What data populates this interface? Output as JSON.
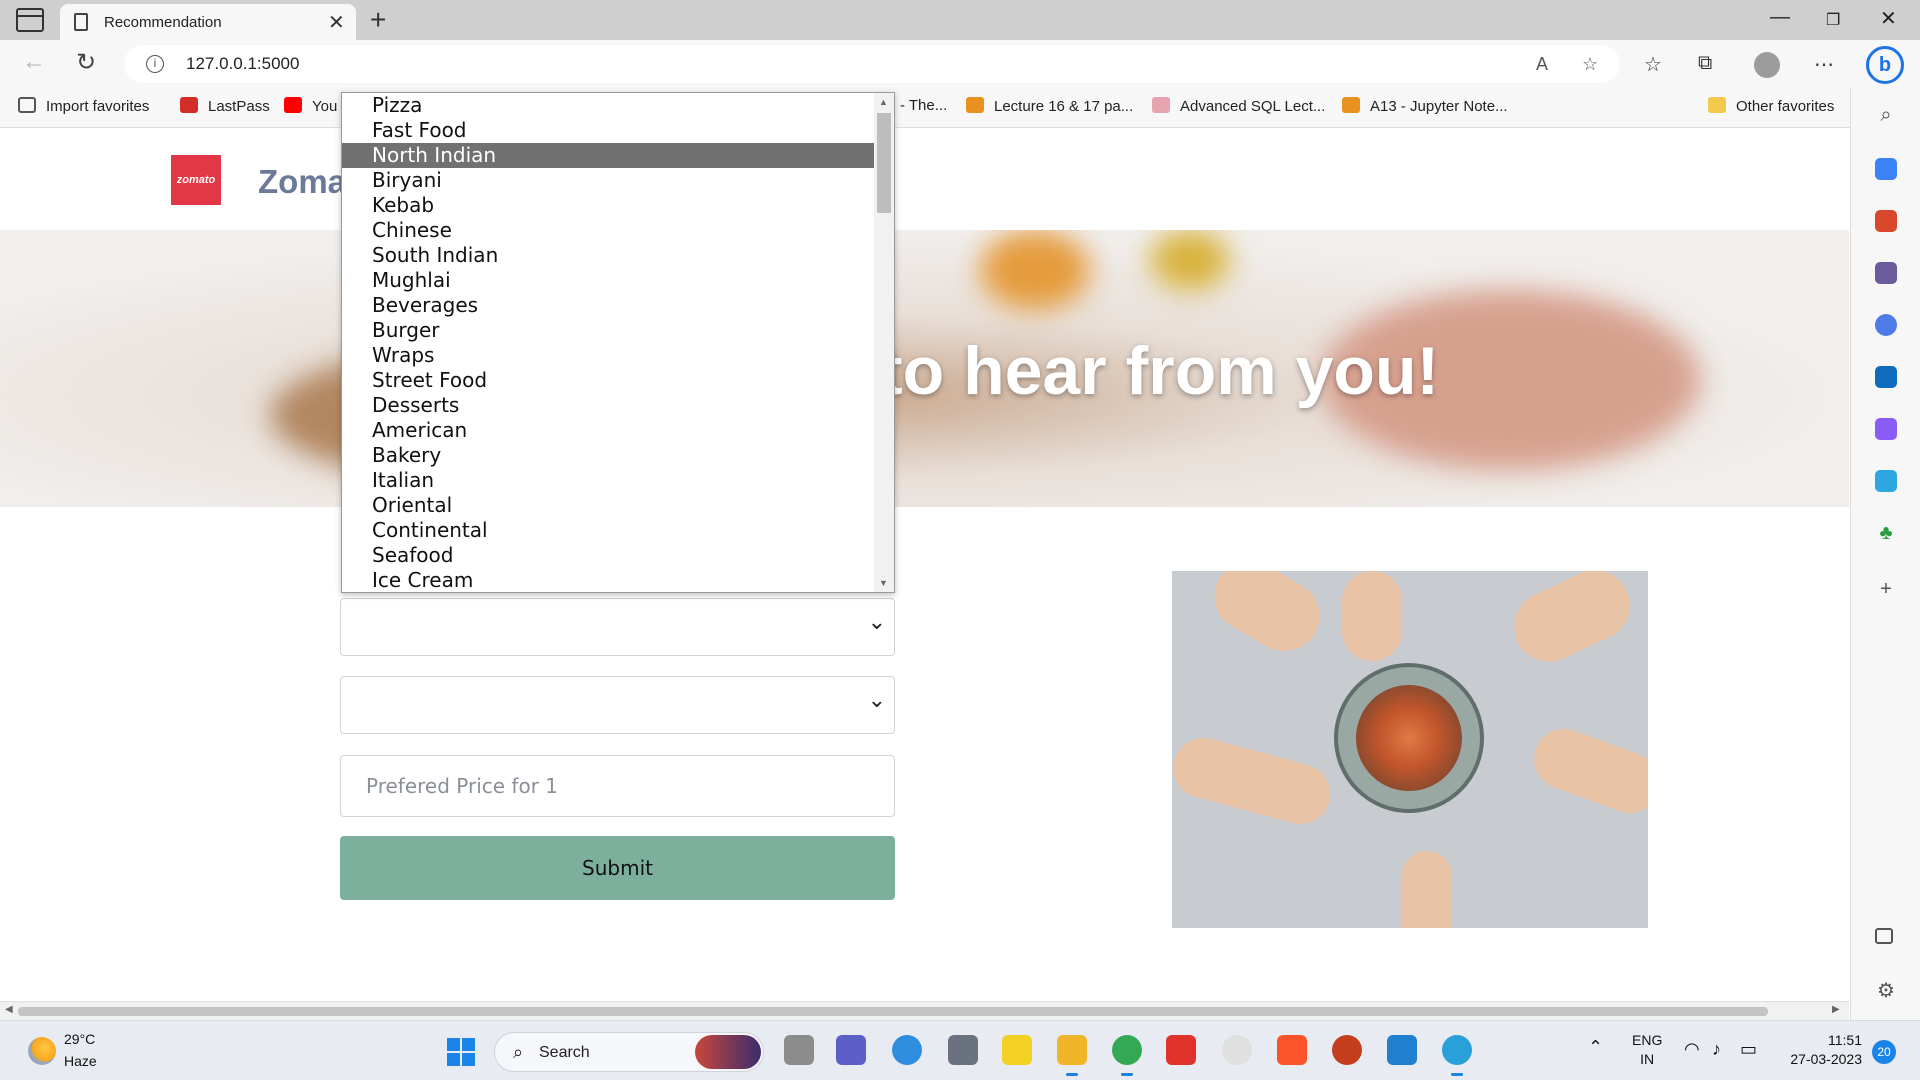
{
  "browser": {
    "tab_title": "Recommendation",
    "url": "127.0.0.1:5000",
    "favorites": [
      {
        "label": "Import favorites",
        "color": "#555555"
      },
      {
        "label": "LastPass",
        "color": "#d32d27"
      },
      {
        "label": "You",
        "color": "#ff0000"
      },
      {
        "label": "- The...",
        "color": "#d88c1a"
      },
      {
        "label": "Lecture 16 & 17 pa...",
        "color": "#e8911e"
      },
      {
        "label": "Advanced SQL Lect...",
        "color": "#e8a3b0"
      },
      {
        "label": "A13 - Jupyter Note...",
        "color": "#e8911e"
      }
    ],
    "other_favorites": "Other favorites"
  },
  "site": {
    "logo_text": "zomato",
    "brand_partial": "Zoma",
    "hero_heading_partial": "to hear from you!"
  },
  "form": {
    "price_placeholder": "Prefered Price for 1",
    "submit_label": "Submit"
  },
  "dropdown": {
    "options": [
      "Pizza",
      "Fast Food",
      "North Indian",
      "Biryani",
      "Kebab",
      "Chinese",
      "South Indian",
      "Mughlai",
      "Beverages",
      "Burger",
      "Wraps",
      "Street Food",
      "Desserts",
      "American",
      "Bakery",
      "Italian",
      "Oriental",
      "Continental",
      "Seafood",
      "Ice Cream"
    ],
    "highlighted": "North Indian"
  },
  "taskbar": {
    "temperature": "29°C",
    "condition": "Haze",
    "search_label": "Search",
    "lang_line1": "ENG",
    "lang_line2": "IN",
    "time": "11:51",
    "date": "27-03-2023",
    "notification_count": "20"
  },
  "colors": {
    "brand_red": "#e23744",
    "submit_green": "#7db09c",
    "highlight_gray": "#717171"
  }
}
